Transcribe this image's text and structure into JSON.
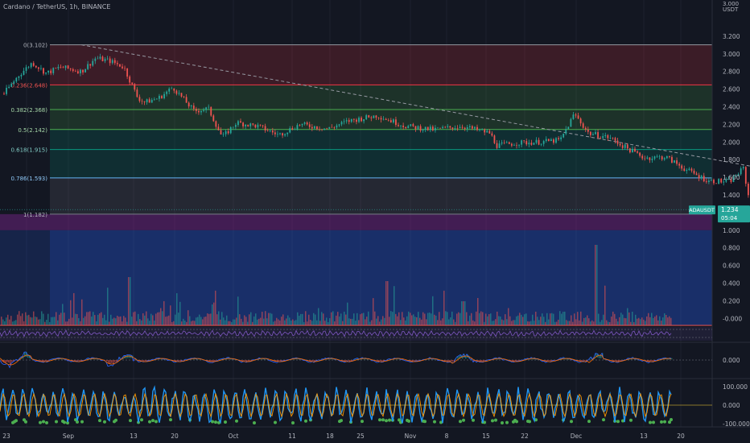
{
  "header": {
    "symbol_title": "Cardano / TetherUS, 1h, BINANCE"
  },
  "price_tag": {
    "symbol": "ADAUSDT",
    "price": "1.234",
    "countdown": "05:04",
    "color": "#26a69a"
  },
  "axis_unit": "USDT",
  "colors": {
    "background": "#131722",
    "up": "#26a69a",
    "down": "#ef5350",
    "trendline": "#9598a1",
    "fib_red": "#f23645",
    "fib_green": "#4caf50",
    "fib_teal": "#089981",
    "fib_blue": "#2962ff",
    "fib_purple": "#9c27b0",
    "rsi_line": "#7e57c2",
    "macd_line": "#2962ff",
    "signal_line": "#ff6d00",
    "stoch_k": "#2196f3",
    "stoch_d": "#ff9800"
  },
  "chart_data": [
    {
      "type": "candlestick",
      "title": "Cardano / TetherUS, 1h, BINANCE",
      "x_ticks": [
        "23",
        "Sep",
        "13",
        "20",
        "Oct",
        "11",
        "18",
        "25",
        "Nov",
        "8",
        "15",
        "22",
        "Dec",
        "13",
        "20"
      ],
      "y_ticks": [
        "3.200",
        "3.000",
        "2.800",
        "2.600",
        "2.400",
        "2.200",
        "2.000",
        "1.800",
        "1.600",
        "1.400",
        "1.200",
        "1.000",
        "0.800",
        "0.600",
        "0.400",
        "0.200",
        "-0.000"
      ],
      "y_top_label": "3.000",
      "ylim": [
        -0.05,
        3.3
      ],
      "price_path": [
        [
          "Aug 20",
          2.55
        ],
        [
          "Aug 22",
          2.75
        ],
        [
          "Aug 24",
          2.9
        ],
        [
          "Aug 26",
          2.78
        ],
        [
          "Aug 28",
          2.85
        ],
        [
          "Aug 31",
          2.8
        ],
        [
          "Sep 2",
          2.95
        ],
        [
          "Sep 4",
          2.92
        ],
        [
          "Sep 6",
          2.85
        ],
        [
          "Sep 8",
          2.5
        ],
        [
          "Sep 9",
          2.45
        ],
        [
          "Sep 11",
          2.5
        ],
        [
          "Sep 13",
          2.62
        ],
        [
          "Sep 16",
          2.35
        ],
        [
          "Sep 18",
          2.38
        ],
        [
          "Sep 20",
          2.05
        ],
        [
          "Sep 22",
          2.22
        ],
        [
          "Sep 25",
          2.18
        ],
        [
          "Sep 28",
          2.08
        ],
        [
          "Oct 1",
          2.2
        ],
        [
          "Oct 5",
          2.15
        ],
        [
          "Oct 8",
          2.24
        ],
        [
          "Oct 12",
          2.3
        ],
        [
          "Oct 16",
          2.18
        ],
        [
          "Oct 20",
          2.14
        ],
        [
          "Oct 24",
          2.18
        ],
        [
          "Oct 28",
          2.1
        ],
        [
          "Oct 29",
          1.96
        ],
        [
          "Nov 1",
          1.99
        ],
        [
          "Nov 4",
          2.0
        ],
        [
          "Nov 7",
          2.02
        ],
        [
          "Nov 9",
          2.32
        ],
        [
          "Nov 11",
          2.1
        ],
        [
          "Nov 14",
          2.05
        ],
        [
          "Nov 16",
          1.95
        ],
        [
          "Nov 19",
          1.82
        ],
        [
          "Nov 22",
          1.83
        ],
        [
          "Nov 25",
          1.68
        ],
        [
          "Nov 28",
          1.56
        ],
        [
          "Dec 1",
          1.55
        ],
        [
          "Dec 3",
          1.7
        ],
        [
          "Dec 4",
          1.26
        ],
        [
          "Dec 7",
          1.36
        ],
        [
          "Dec 10",
          1.3
        ],
        [
          "Dec 13",
          1.28
        ],
        [
          "Dec 15",
          1.24
        ],
        [
          "Dec 17",
          1.234
        ]
      ]
    },
    {
      "type": "fibonacci_retracement",
      "levels": [
        {
          "ratio": "0",
          "label": "0(3.102)",
          "value": 3.102
        },
        {
          "ratio": "0.236",
          "label": "0.236(2.648)",
          "value": 2.648
        },
        {
          "ratio": "0.382",
          "label": "0.382(2.368)",
          "value": 2.368
        },
        {
          "ratio": "0.5",
          "label": "0.5(2.142)",
          "value": 2.142
        },
        {
          "ratio": "0.618",
          "label": "0.618(1.915)",
          "value": 1.915
        },
        {
          "ratio": "0.786",
          "label": "0.786(1.593)",
          "value": 1.593
        },
        {
          "ratio": "1",
          "label": "1(1.182)",
          "value": 1.182
        }
      ],
      "extra_bands": [
        {
          "from": 1.182,
          "to": 1.0,
          "color": "#9c27b0"
        },
        {
          "from": 1.0,
          "to": -0.05,
          "color": "#2962ff"
        }
      ]
    },
    {
      "type": "trendline",
      "points": [
        [
          "Aug 31",
          3.102
        ],
        [
          "Dec 20",
          1.52
        ]
      ],
      "style": "dashed"
    },
    {
      "type": "bar",
      "name": "volume",
      "note": "volume histogram overlaid at the bottom of the main pane"
    },
    {
      "type": "line",
      "name": "macd",
      "y_ticks": [
        "0.000"
      ]
    },
    {
      "type": "line",
      "name": "stochastic",
      "y_ticks": [
        "100.000",
        "0.000",
        "-100.000"
      ]
    }
  ]
}
